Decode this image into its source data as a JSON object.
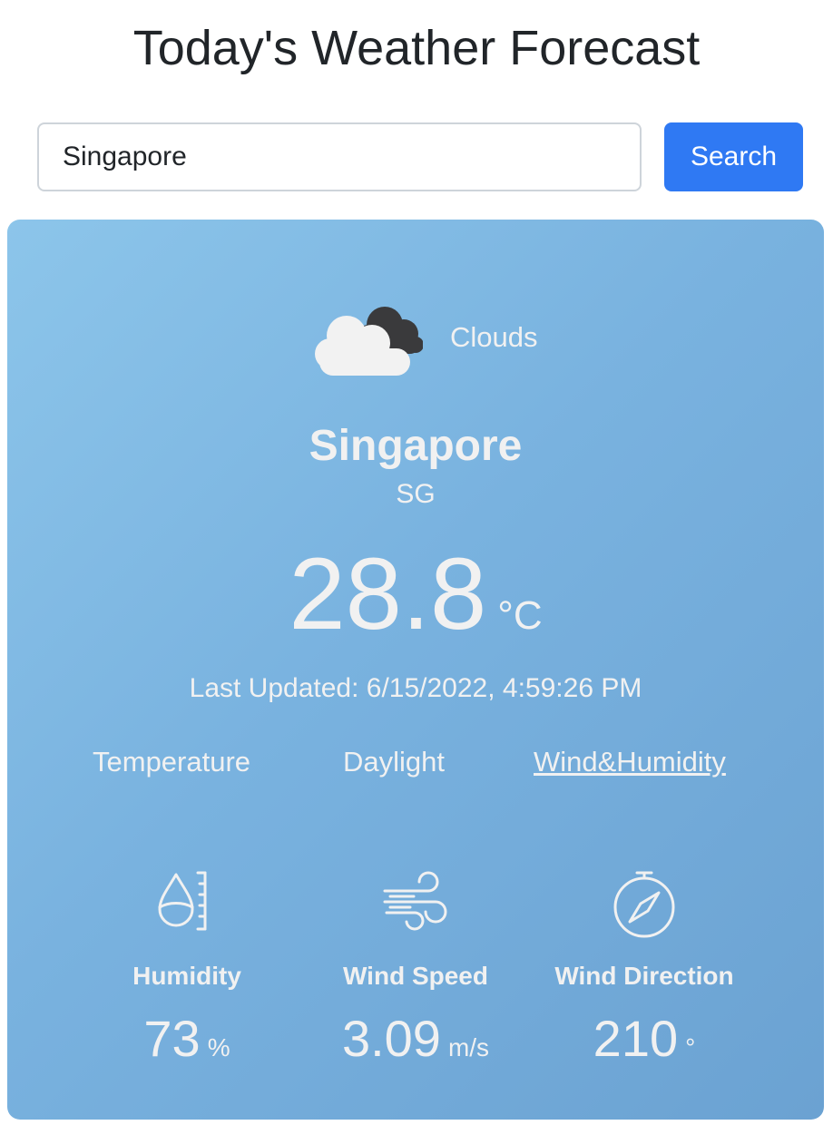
{
  "page": {
    "title": "Today's Weather Forecast"
  },
  "search": {
    "value": "Singapore",
    "button_label": "Search"
  },
  "weather": {
    "condition": "Clouds",
    "condition_icon": "cloud-icon",
    "city": "Singapore",
    "country": "SG",
    "temperature": "28.8",
    "temperature_unit": "°C",
    "last_updated": "Last Updated: 6/15/2022, 4:59:26 PM"
  },
  "tabs": [
    {
      "label": "Temperature",
      "active": false
    },
    {
      "label": "Daylight",
      "active": false
    },
    {
      "label": "Wind&Humidity",
      "active": true
    }
  ],
  "stats": [
    {
      "label": "Humidity",
      "value": "73",
      "unit": "%",
      "icon": "humidity-icon"
    },
    {
      "label": "Wind Speed",
      "value": "3.09",
      "unit": "m/s",
      "icon": "wind-icon"
    },
    {
      "label": "Wind Direction",
      "value": "210",
      "unit": "°",
      "icon": "compass-icon"
    }
  ],
  "colors": {
    "accent": "#2f79f3",
    "card_gradient_start": "#8cc5ea",
    "card_gradient_end": "#6ba2d2",
    "card_text": "#f1f1f1"
  }
}
